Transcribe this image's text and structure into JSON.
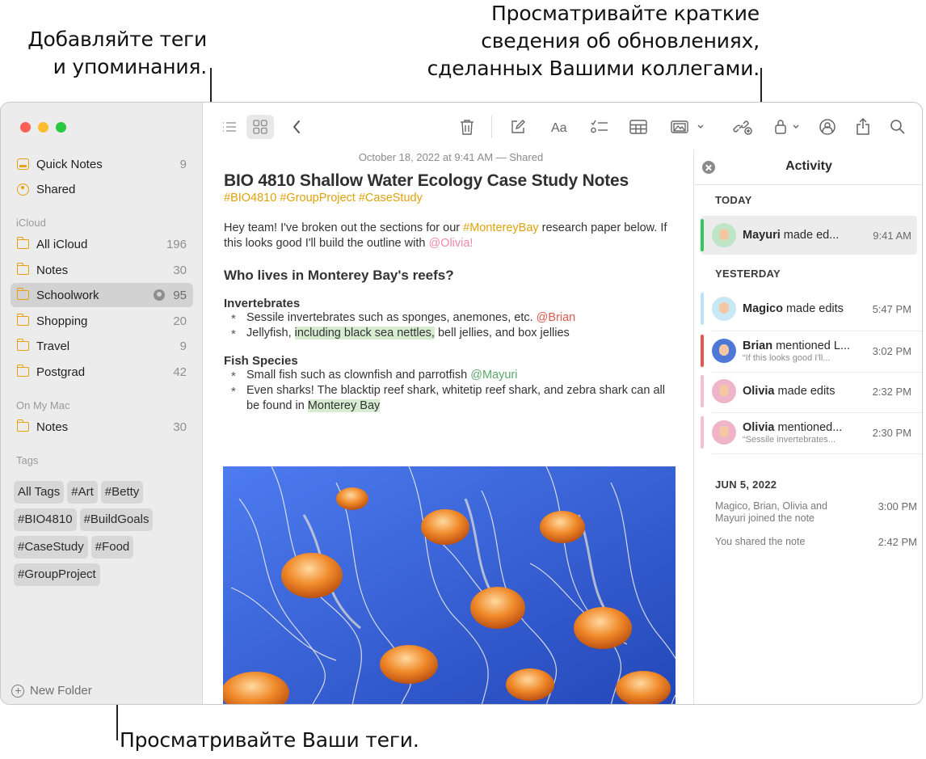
{
  "callouts": {
    "tags_mentions": "Добавляйте теги\nи упоминания.",
    "activity": "Просматривайте краткие\nсведения об обновлениях,\nсделанных Вашими коллегами.",
    "view_tags": "Просматривайте Ваши теги."
  },
  "sidebar": {
    "top_items": [
      {
        "label": "Quick Notes",
        "count": "9"
      },
      {
        "label": "Shared",
        "count": ""
      }
    ],
    "icloud_header": "iCloud",
    "icloud_items": [
      {
        "label": "All iCloud",
        "count": "196"
      },
      {
        "label": "Notes",
        "count": "30"
      },
      {
        "label": "Schoolwork",
        "count": "95"
      },
      {
        "label": "Shopping",
        "count": "20"
      },
      {
        "label": "Travel",
        "count": "9"
      },
      {
        "label": "Postgrad",
        "count": "42"
      }
    ],
    "mac_header": "On My Mac",
    "mac_items": [
      {
        "label": "Notes",
        "count": "30"
      }
    ],
    "tags_header": "Tags",
    "tags": [
      "All Tags",
      "#Art",
      "#Betty",
      "#BIO4810",
      "#BuildGoals",
      "#CaseStudy",
      "#Food",
      "#GroupProject"
    ],
    "new_folder": "New Folder"
  },
  "note": {
    "date": "October 18, 2022 at 9:41 AM — Shared",
    "title": "BIO 4810 Shallow Water Ecology Case Study Notes",
    "hashtags": "#BIO4810 #GroupProject #CaseStudy",
    "intro_1": "Hey team! I've broken out the sections for our ",
    "intro_tag": "#MontereyBay",
    "intro_2": " research paper below. If this looks good I'll build the outline with ",
    "intro_mention": "@Olivia!",
    "heading": "Who lives in Monterey Bay's reefs?",
    "sec1_title": "Invertebrates",
    "sec1_b1": "Sessile invertebrates such as sponges, anemones, etc. ",
    "sec1_b1_mention": "@Brian",
    "sec1_b2_a": "Jellyfish, ",
    "sec1_b2_hl": "including black sea nettles,",
    "sec1_b2_b": " bell jellies, and box jellies",
    "sec2_title": "Fish Species",
    "sec2_b1": "Small fish such as clownfish and parrotfish ",
    "sec2_b1_mention": "@Mayuri",
    "sec2_b2_a": "Even sharks! The blacktip reef shark, whitetip reef shark, and zebra shark can all be found in ",
    "sec2_b2_hl": "Monterey Bay"
  },
  "activity": {
    "title": "Activity",
    "today_label": "TODAY",
    "yesterday_label": "YESTERDAY",
    "jun_label": "JUN 5, 2022",
    "today": [
      {
        "name": "Mayuri",
        "action": " made ed...",
        "sub": "",
        "time": "9:41 AM",
        "color": "#34c759"
      }
    ],
    "yesterday": [
      {
        "name": "Magico",
        "action": " made edits",
        "sub": "",
        "time": "5:47 PM",
        "color": "#b9e4f5"
      },
      {
        "name": "Brian",
        "action": " mentioned L...",
        "sub": "“If this looks good I'll...",
        "time": "3:02 PM",
        "color": "#e5584b"
      },
      {
        "name": "Olivia",
        "action": " made edits",
        "sub": "",
        "time": "2:32 PM",
        "color": "#f5c0d0"
      },
      {
        "name": "Olivia",
        "action": " mentioned...",
        "sub": "“Sessile invertebrates...",
        "time": "2:30 PM",
        "color": "#f5c0d0"
      }
    ],
    "jun": [
      {
        "text": "Magico, Brian, Olivia and Mayuri joined the note",
        "time": "3:00 PM"
      },
      {
        "text": "You shared the note",
        "time": "2:42 PM"
      }
    ]
  }
}
